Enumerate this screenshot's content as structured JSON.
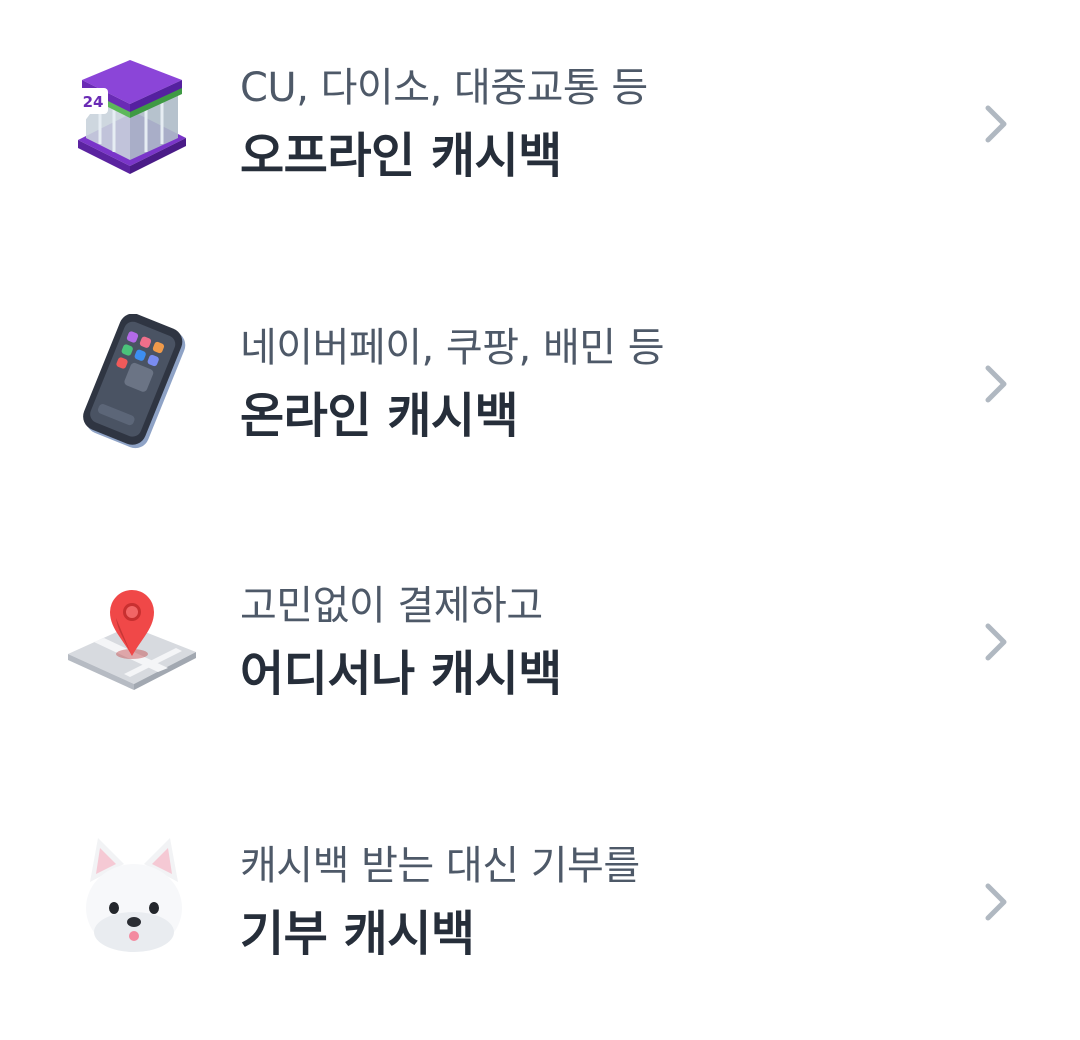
{
  "items": [
    {
      "subtitle": "CU, 다이소, 대중교통 등",
      "title": "오프라인 캐시백",
      "icon": "convenience-store-icon",
      "badge": "24"
    },
    {
      "subtitle": "네이버페이, 쿠팡, 배민 등",
      "title": "온라인 캐시백",
      "icon": "smartphone-icon"
    },
    {
      "subtitle": "고민없이 결제하고",
      "title": "어디서나 캐시백",
      "icon": "map-pin-icon"
    },
    {
      "subtitle": "캐시백 받는 대신 기부를",
      "title": "기부 캐시백",
      "icon": "dog-icon"
    }
  ],
  "colors": {
    "subtitle": "#4e5968",
    "title": "#262e3a",
    "chevron": "#b0b8c1"
  }
}
